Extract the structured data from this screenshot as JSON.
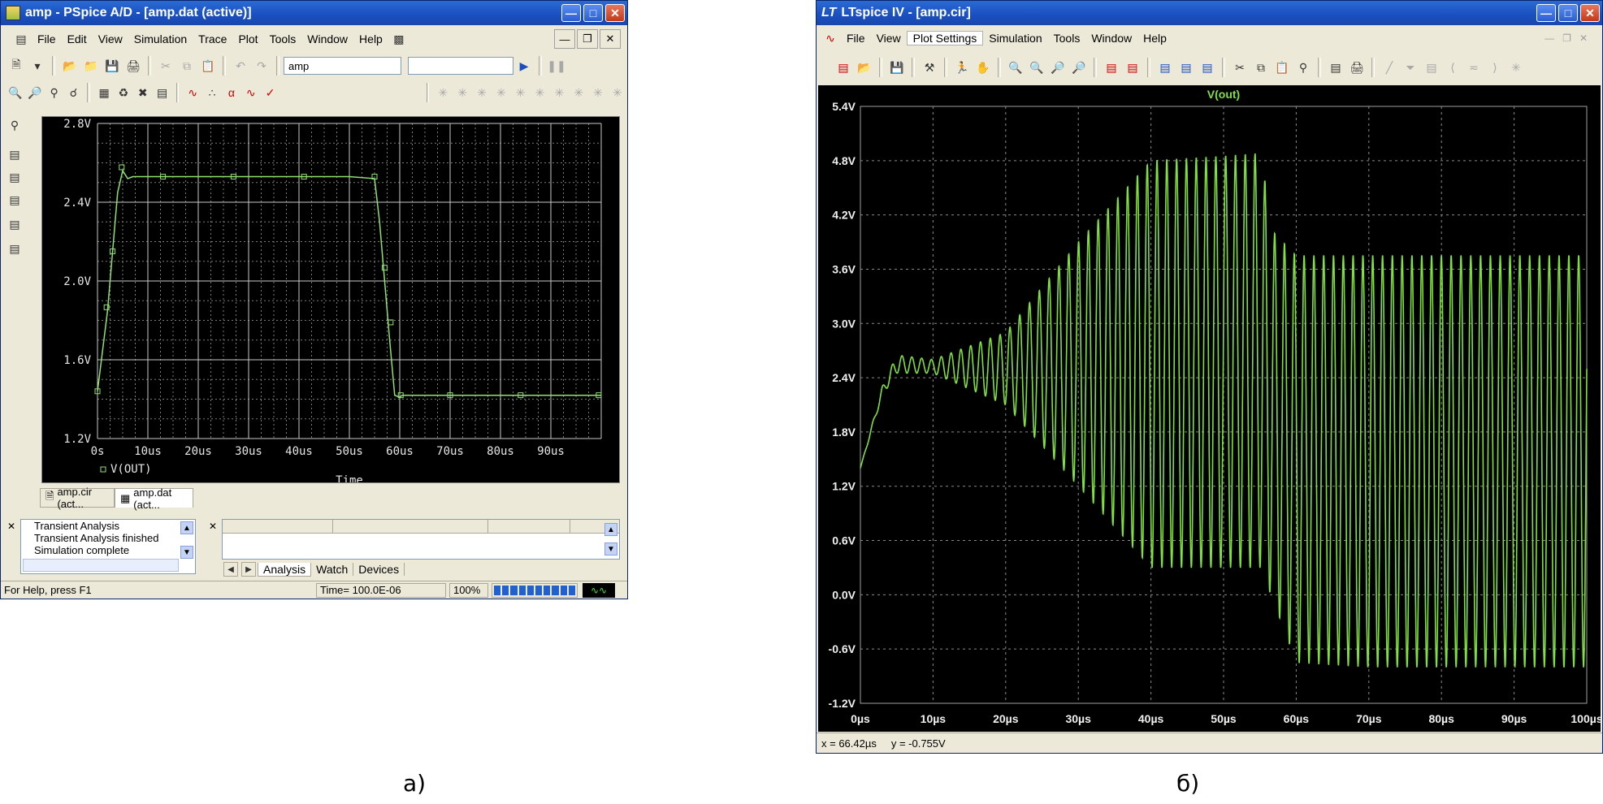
{
  "pspice": {
    "title": "amp - PSpice A/D  - [amp.dat (active)]",
    "menu": [
      "File",
      "Edit",
      "View",
      "Simulation",
      "Trace",
      "Plot",
      "Tools",
      "Window",
      "Help"
    ],
    "profile_combo": "amp",
    "plot": {
      "y_ticks": [
        "2.8V",
        "2.4V",
        "2.0V",
        "1.6V",
        "1.2V"
      ],
      "x_ticks": [
        "0s",
        "10us",
        "20us",
        "30us",
        "40us",
        "50us",
        "60us",
        "70us",
        "80us",
        "90us"
      ],
      "legend": "V(OUT)",
      "xlabel": "Time",
      "color": "#90e070"
    },
    "tabs": [
      "amp.cir (act...",
      "amp.dat (act..."
    ],
    "output_lines": [
      "Transient Analysis",
      "Transient Analysis finished",
      "Simulation complete"
    ],
    "watch_tabs": [
      "Analysis",
      "Watch",
      "Devices"
    ],
    "status": {
      "help": "For Help, press F1",
      "time": "Time= 100.0E-06",
      "percent": "100%"
    }
  },
  "ltspice": {
    "title": "LTspice IV - [amp.cir]",
    "menu": [
      "File",
      "View",
      "Plot Settings",
      "Simulation",
      "Tools",
      "Window",
      "Help"
    ],
    "plot": {
      "trace_label": "V(out)",
      "y_ticks": [
        "5.4V",
        "4.8V",
        "4.2V",
        "3.6V",
        "3.0V",
        "2.4V",
        "1.8V",
        "1.2V",
        "0.6V",
        "0.0V",
        "-0.6V",
        "-1.2V"
      ],
      "x_ticks": [
        "0µs",
        "10µs",
        "20µs",
        "30µs",
        "40µs",
        "50µs",
        "60µs",
        "70µs",
        "80µs",
        "90µs",
        "100µs"
      ],
      "color": "#80e040"
    },
    "status": {
      "x": "x = 66.42µs",
      "y": "y = -0.755V"
    }
  },
  "captions": {
    "left": "а)",
    "right": "б)"
  },
  "chart_data": [
    {
      "type": "line",
      "series": [
        {
          "name": "V(OUT)",
          "x": [
            0,
            2,
            4,
            5,
            6,
            7,
            10,
            20,
            30,
            40,
            50,
            55,
            56,
            57,
            58,
            59,
            60,
            60.5,
            62,
            65,
            70,
            80,
            100
          ],
          "y": [
            1.44,
            1.85,
            2.45,
            2.56,
            2.52,
            2.53,
            2.53,
            2.53,
            2.53,
            2.53,
            2.53,
            2.52,
            2.3,
            2.0,
            1.7,
            1.42,
            1.41,
            1.42,
            1.42,
            1.42,
            1.42,
            1.42,
            1.42
          ]
        }
      ],
      "xlabel": "Time",
      "x_unit": "us",
      "xlim": [
        0,
        100
      ],
      "ylim": [
        1.2,
        2.8
      ],
      "grid": true
    },
    {
      "type": "line",
      "series": [
        {
          "name": "V(out)",
          "description_envelope": {
            "x": [
              0,
              3,
              5,
              10,
              20,
              30,
              40,
              50,
              55,
              57,
              60,
              70,
              80,
              90,
              100
            ],
            "upper": [
              1.4,
              2.3,
              2.65,
              2.6,
              2.9,
              3.9,
              4.8,
              4.85,
              4.88,
              4.0,
              3.75,
              3.75,
              3.75,
              3.75,
              3.75
            ],
            "lower": [
              1.4,
              2.2,
              2.45,
              2.45,
              2.1,
              1.2,
              0.3,
              0.3,
              0.3,
              -0.1,
              -0.75,
              -0.8,
              -0.8,
              -0.8,
              -0.8
            ]
          }
        }
      ],
      "xlim": [
        0,
        100
      ],
      "ylim": [
        -1.2,
        5.4
      ],
      "grid": true
    }
  ]
}
